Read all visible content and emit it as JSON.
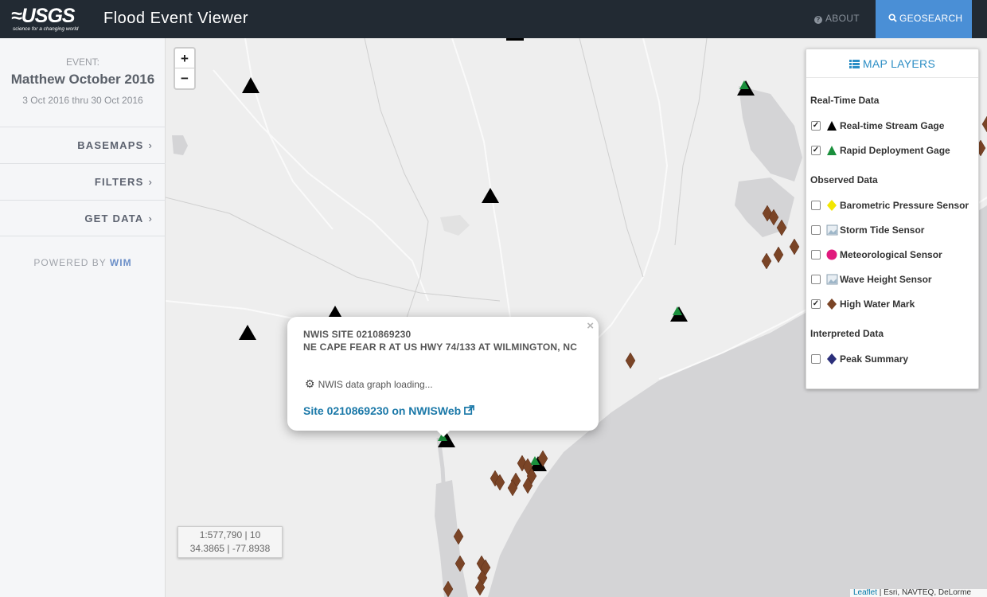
{
  "header": {
    "logo_text": "≈USGS",
    "logo_tagline": "science for a changing world",
    "title": "Flood Event Viewer",
    "about_label": "ABOUT",
    "geosearch_label": "GEOSEARCH"
  },
  "sidebar": {
    "event_label": "EVENT:",
    "event_name": "Matthew October 2016",
    "event_dates": "3 Oct 2016 thru 30 Oct 2016",
    "menu": [
      {
        "label": "BASEMAPS"
      },
      {
        "label": "FILTERS"
      },
      {
        "label": "GET DATA"
      }
    ],
    "powered_by": "POWERED BY",
    "powered_brand": "WIM"
  },
  "map": {
    "zoom_in": "+",
    "zoom_out": "−",
    "scale_text": "1:577,790 | 10",
    "coords_text": "34.3865 | -77.8938",
    "attribution_leaflet": "Leaflet",
    "attribution_rest": " | Esri, NAVTEQ, DeLorme",
    "colors": {
      "water": "#d4d4d6",
      "land": "#eeeeee",
      "stream_gage": "#000000",
      "rapid_gage": "#1a8f3c",
      "hwm": "#7a4426"
    }
  },
  "popup": {
    "close": "×",
    "site_line": "NWIS SITE 0210869230",
    "site_name": "NE CAPE FEAR R AT US HWY 74/133 AT WILMINGTON, NC",
    "loading_text": "NWIS data graph loading...",
    "link_text": "Site 0210869230 on NWISWeb"
  },
  "layers": {
    "header": "MAP LAYERS",
    "sections": [
      {
        "title": "Real-Time Data"
      },
      {
        "title": "Observed Data"
      },
      {
        "title": "Interpreted Data"
      }
    ],
    "items": [
      {
        "label": "Real-time Stream Gage",
        "checked": true,
        "symbol": "black-triangle"
      },
      {
        "label": "Rapid Deployment Gage",
        "checked": true,
        "symbol": "green-triangle"
      },
      {
        "label": "Barometric Pressure Sensor",
        "checked": false,
        "symbol": "yellow-diamond"
      },
      {
        "label": "Storm Tide Sensor",
        "checked": false,
        "symbol": "image-icon"
      },
      {
        "label": "Meteorological Sensor",
        "checked": false,
        "symbol": "magenta-circle"
      },
      {
        "label": "Wave Height Sensor",
        "checked": false,
        "symbol": "image-icon"
      },
      {
        "label": "High Water Mark",
        "checked": true,
        "symbol": "brown-diamond"
      },
      {
        "label": "Peak Summary",
        "checked": false,
        "symbol": "navy-diamond"
      }
    ]
  }
}
